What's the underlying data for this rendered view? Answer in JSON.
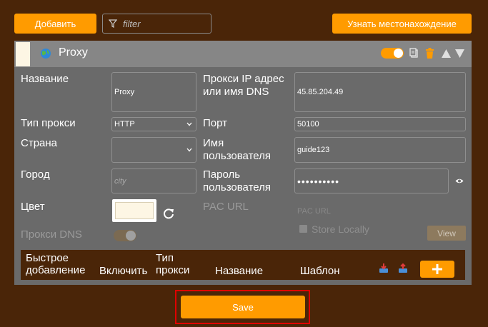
{
  "toolbar": {
    "add_label": "Добавить",
    "filter_placeholder": "filter",
    "locate_label": "Узнать местонахождение"
  },
  "proxy": {
    "title": "Proxy",
    "enabled": true,
    "color": "#fdf6e4"
  },
  "form": {
    "name_label": "Название",
    "name_value": "Proxy",
    "type_label": "Тип прокси",
    "type_value": "HTTP",
    "country_label": "Страна",
    "country_value": "",
    "city_label": "Город",
    "city_placeholder": "city",
    "color_label": "Цвет",
    "dns_label": "Прокси DNS",
    "ip_label": "Прокси IP адрес или имя DNS",
    "ip_value": "45.85.204.49",
    "port_label": "Порт",
    "port_value": "50100",
    "user_label": "Имя пользователя",
    "user_value": "guide123",
    "pass_label": "Пароль пользователя",
    "pass_value": "••••••••••",
    "pac_label": "PAC URL",
    "pac_placeholder": "PAC URL",
    "store_label": "Store Locally",
    "view_label": "View"
  },
  "quick_add": {
    "title": "Быстрое добавление",
    "col_enable": "Включить",
    "col_type": "Тип прокси",
    "col_name": "Название",
    "col_template": "Шаблон"
  },
  "save_label": "Save",
  "colors": {
    "accent": "#ff9b00",
    "background": "#4a2508",
    "panel": "#6a6a6a",
    "highlight": "#e00000"
  }
}
